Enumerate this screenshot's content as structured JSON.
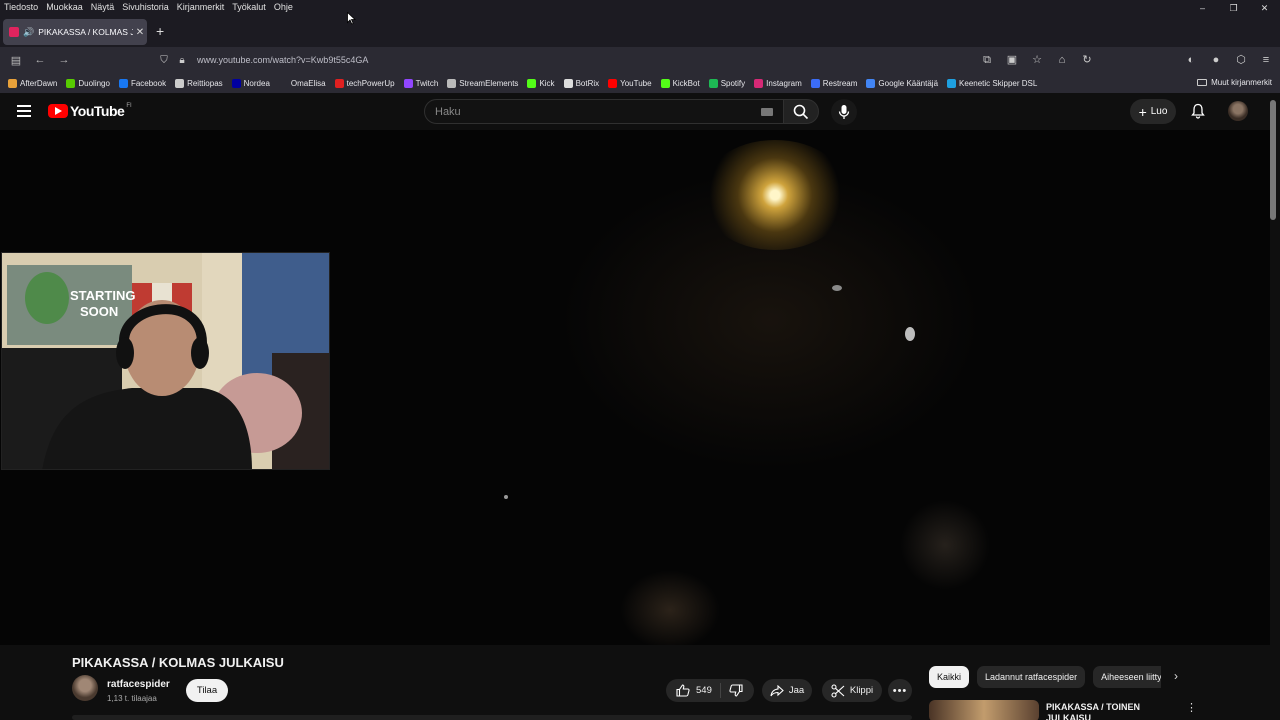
{
  "menubar": {
    "items": [
      "Tiedosto",
      "Muokkaa",
      "Näytä",
      "Sivuhistoria",
      "Kirjanmerkit",
      "Työkalut",
      "Ohje"
    ],
    "window_controls": [
      "–",
      "❐",
      "✕"
    ]
  },
  "tab": {
    "title": "PIKAKASSA / KOLMAS JULKAISU",
    "close": "✕",
    "audio_icon": "speaker-icon"
  },
  "newtab_label": "+",
  "navbar": {
    "url": "www.youtube.com/watch?v=Kwb9t55c4GA"
  },
  "bookmarks": [
    {
      "label": "AfterDawn",
      "color": "#e8a13a"
    },
    {
      "label": "Duolingo",
      "color": "#58cc02"
    },
    {
      "label": "Facebook",
      "color": "#1877f2"
    },
    {
      "label": "Reittiopas",
      "color": "#cccccc"
    },
    {
      "label": "Nordea",
      "color": "#0000a0"
    },
    {
      "label": "OmaElisa",
      "color": "#2b2a33"
    },
    {
      "label": "techPowerUp",
      "color": "#e02020"
    },
    {
      "label": "Twitch",
      "color": "#9146ff"
    },
    {
      "label": "StreamElements",
      "color": "#bbbbbb"
    },
    {
      "label": "Kick",
      "color": "#53fc18"
    },
    {
      "label": "BotRix",
      "color": "#dddddd"
    },
    {
      "label": "YouTube",
      "color": "#ff0000"
    },
    {
      "label": "KickBot",
      "color": "#53fc18"
    },
    {
      "label": "Spotify",
      "color": "#1db954"
    },
    {
      "label": "Instagram",
      "color": "#d62976"
    },
    {
      "label": "Restream",
      "color": "#3b6cf6"
    },
    {
      "label": "Google Kääntäjä",
      "color": "#4285f4"
    },
    {
      "label": "Keenetic Skipper DSL",
      "color": "#1ea0e0"
    }
  ],
  "bookmarks_other": "Muut kirjanmerkit",
  "youtube": {
    "logo_text": "YouTube",
    "country": "FI",
    "search_placeholder": "Haku",
    "create_label": "Luo"
  },
  "video": {
    "title": "PIKAKASSA / KOLMAS JULKAISU",
    "channel": "ratfacespider",
    "subscribers": "1,13 t. tilaajaa",
    "subscribe_label": "Tilaa",
    "likes": "549",
    "share_label": "Jaa",
    "clip_label": "Klippi"
  },
  "chips": [
    "Kaikki",
    "Ladannut ratfacespider",
    "Aiheeseen liittyvät"
  ],
  "recommendation": {
    "title": "PIKAKASSA / TOINEN JULKAISU"
  }
}
